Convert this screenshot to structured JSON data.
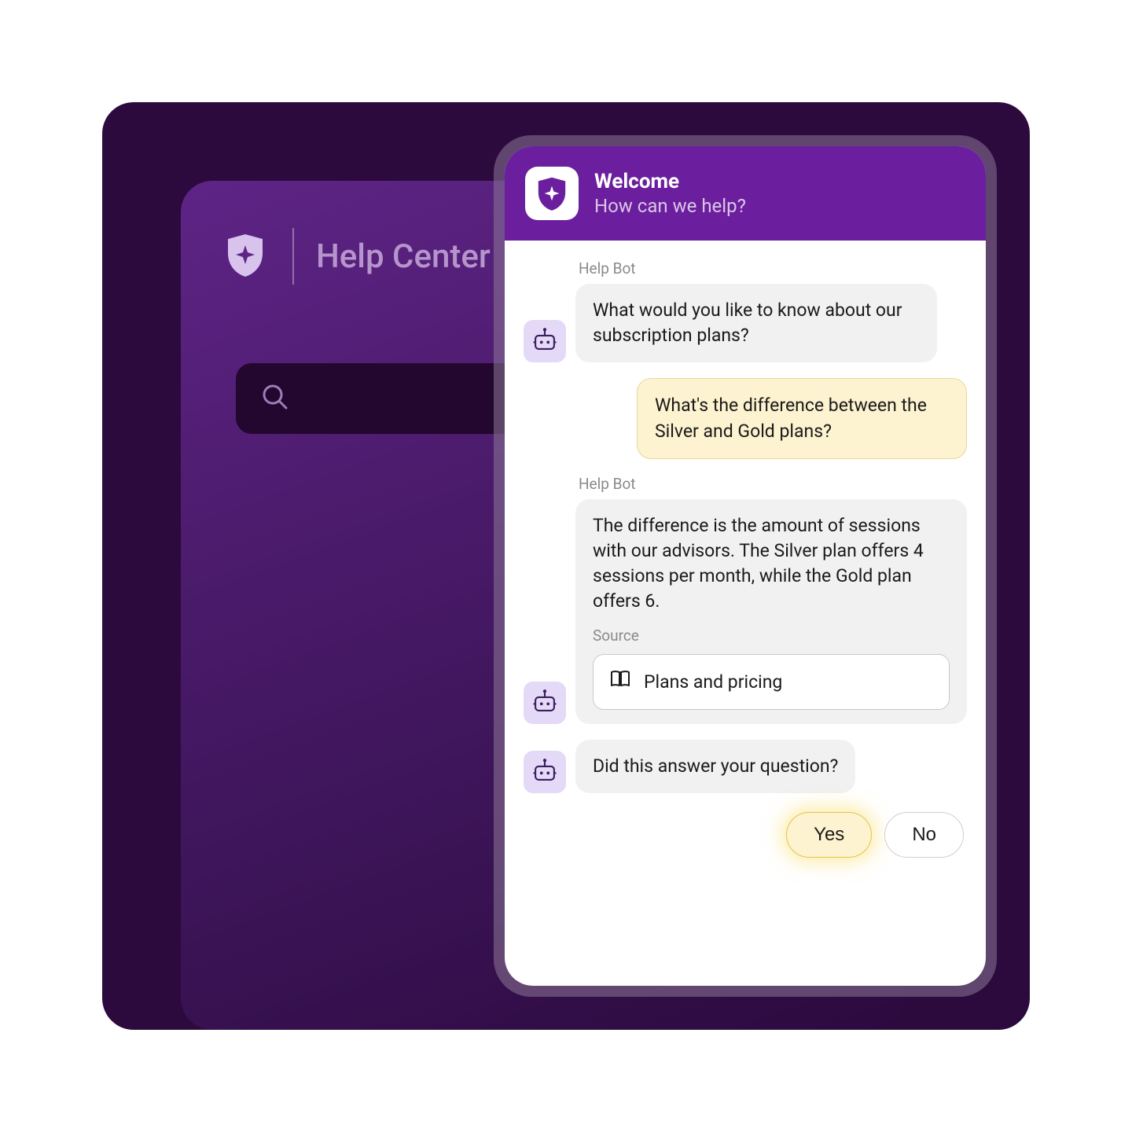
{
  "help_center": {
    "title": "Help Center"
  },
  "chat": {
    "header": {
      "title": "Welcome",
      "subtitle": "How can we help?"
    },
    "bot_name": "Help Bot",
    "messages": {
      "bot1": "What would you like to know about our subscription plans?",
      "user1": "What's the difference between the Silver and Gold plans?",
      "bot2": "The difference is the amount of sessions with our advisors. The Silver plan offers 4  sessions per month, while the Gold plan offers 6.",
      "bot3": "Did this answer your question?"
    },
    "source": {
      "label": "Source",
      "title": "Plans and pricing"
    },
    "feedback": {
      "yes": "Yes",
      "no": "No"
    }
  }
}
